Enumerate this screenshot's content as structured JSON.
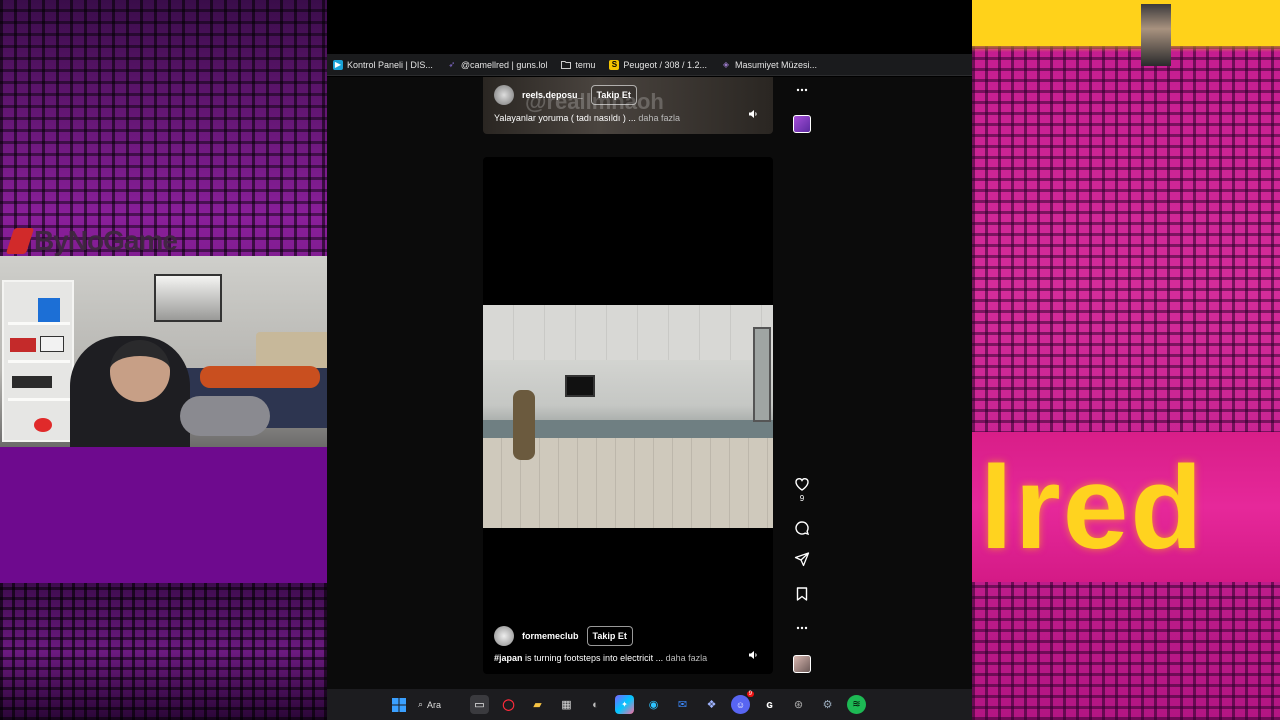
{
  "overlay": {
    "left_logo": "ByNoGame",
    "right_word": "lred"
  },
  "bookmarks": [
    {
      "label": "Kontrol Paneli | DIS...",
      "icon": "panel-icon",
      "color": "#1aa3d8"
    },
    {
      "label": "@camellred | guns.lol",
      "icon": "rocket-icon",
      "color": "#8a6fd6"
    },
    {
      "label": "temu",
      "icon": "folder-icon",
      "color": "#cccccc"
    },
    {
      "label": "Peugeot / 308 / 1.2...",
      "icon": "s-icon",
      "color": "#f4c400"
    },
    {
      "label": "Masumiyet Müzesi...",
      "icon": "museum-icon",
      "color": "#9a7ac8"
    }
  ],
  "reel_top": {
    "username": "reels.deposu_",
    "follow_label": "Takip Et",
    "caption": "Yalayanlar yoruma ( tadı nasıldı ) ...",
    "more_label": "daha fazla",
    "watermark": "@reallmnaoh"
  },
  "reel_main": {
    "username": "formemeclub",
    "follow_label": "Takip Et",
    "caption_tag": "#japan",
    "caption": " is turning footsteps into electricit ...",
    "more_label": "daha fazla"
  },
  "actions": {
    "like_count": "9"
  },
  "taskbar": {
    "search_label": "Ara",
    "discord_badge": "9"
  },
  "colors": {
    "left_purple": "#6e0a8e",
    "right_pink": "#d42c9a",
    "right_yellow": "#ffd21a"
  }
}
